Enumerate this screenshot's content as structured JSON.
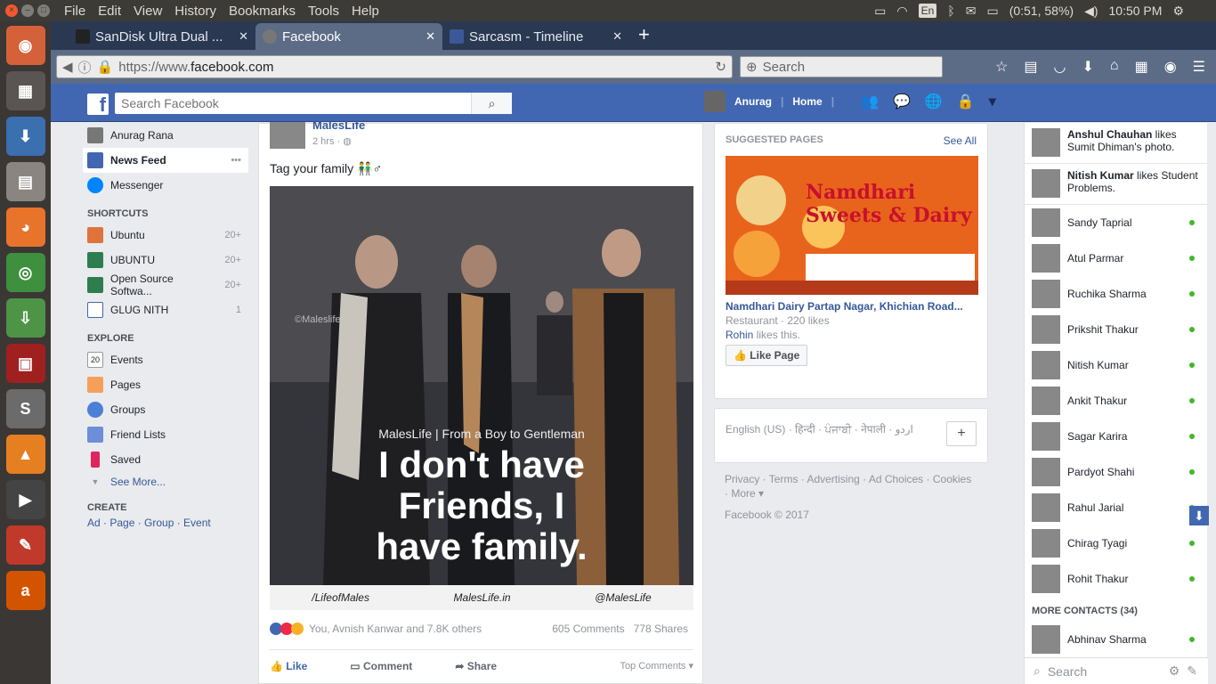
{
  "menubar": {
    "items": [
      "File",
      "Edit",
      "View",
      "History",
      "Bookmarks",
      "Tools",
      "Help"
    ],
    "lang": "En",
    "battery": "(0:51, 58%)",
    "clock": "10:50 PM"
  },
  "tabs": [
    {
      "title": "SanDisk Ultra Dual ...",
      "color": "#222222"
    },
    {
      "title": "Facebook",
      "color": "#777777"
    },
    {
      "title": "Sarcasm - Timeline",
      "color": "#3b5998"
    }
  ],
  "urlbar": {
    "prefix": "https://www.",
    "domain": "facebook.com",
    "search_placeholder": "Search"
  },
  "fb": {
    "search_placeholder": "Search Facebook",
    "user": "Anurag",
    "home": "Home"
  },
  "left": {
    "profile": "Anurag Rana",
    "news_feed": "News Feed",
    "messenger": "Messenger",
    "shortcuts_head": "SHORTCUTS",
    "shortcuts": [
      {
        "label": "Ubuntu",
        "count": "20+",
        "color": "#e0733b"
      },
      {
        "label": "UBUNTU",
        "count": "20+",
        "color": "#2e7d4f"
      },
      {
        "label": "Open Source Softwa...",
        "count": "20+",
        "color": "#2e7d4f"
      },
      {
        "label": "GLUG NITH",
        "count": "1",
        "color": "#4267b2"
      }
    ],
    "explore_head": "EXPLORE",
    "explore": [
      "Events",
      "Pages",
      "Groups",
      "Friend Lists",
      "Saved",
      "See More..."
    ],
    "create_head": "CREATE",
    "create": "Ad · Page · Group · Event"
  },
  "post": {
    "author": "MalesLife",
    "time": "2 hrs · ",
    "text": "Tag your family 👬♂",
    "img_caption_small": "MalesLife | From a Boy to Gentleman",
    "img_caption_big": "I don't have\nFriends, I\nhave family.",
    "watermark": "©Maleslife",
    "footer": [
      "/LifeofMales",
      "MalesLife.in",
      "@MalesLife"
    ],
    "reactions": "You, Avnish Kanwar and 7.8K others",
    "comments": "605 Comments",
    "shares": "778 Shares",
    "like": "Like",
    "comment": "Comment",
    "share": "Share",
    "top_comments": "Top Comments ▾"
  },
  "suggested": {
    "head": "SUGGESTED PAGES",
    "see_all": "See All",
    "ad_title": "Namdhari Sweets & Dairy",
    "name": "Namdhari Dairy Partap Nagar, Khichian Road...",
    "sub": "Restaurant · 220 likes",
    "liker": "Rohin",
    "liker_rest": " likes this.",
    "like_btn": "Like Page"
  },
  "langs": {
    "text": "English (US) · हिन्दी · ਪੰਜਾਬੀ · नेपाली · اردو",
    "add": "+"
  },
  "footer": {
    "links": "Privacy · Terms · Advertising · Ad Choices · Cookies · More ▾",
    "copyright": "Facebook © 2017"
  },
  "ticker": [
    {
      "name": "Anshul Chauhan",
      "rest": " likes Sumit Dhiman's photo."
    },
    {
      "name": "Nitish Kumar",
      "rest": " likes Student Problems."
    }
  ],
  "contacts": [
    "Sandy Taprial",
    "Atul Parmar",
    "Ruchika Sharma",
    "Prikshit Thakur",
    "Nitish Kumar",
    "Ankit Thakur",
    "Sagar Karira",
    "Pardyot Shahi",
    "Rahul Jarial",
    "Chirag Tyagi",
    "Rohit Thakur"
  ],
  "more_contacts": "MORE CONTACTS (34)",
  "more_list": [
    "Abhinav Sharma"
  ],
  "chat_search": "Search"
}
